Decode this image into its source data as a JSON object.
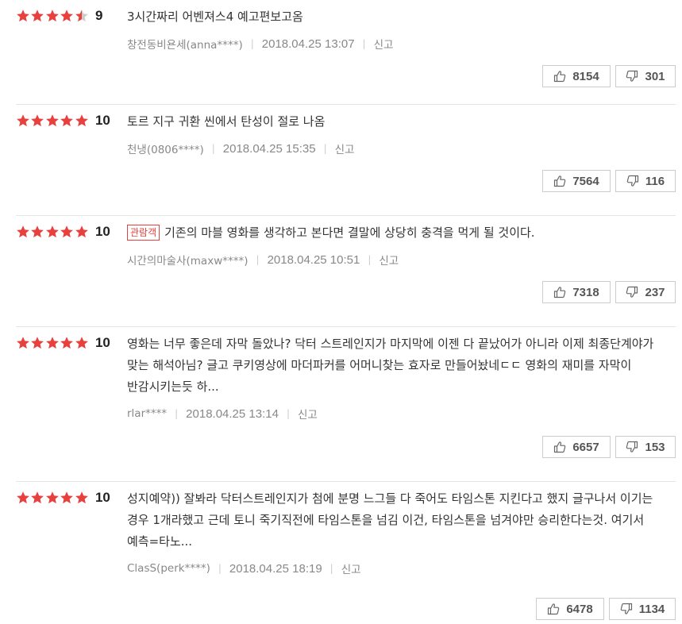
{
  "colors": {
    "star_full": "#e8403d",
    "star_empty": "#cccccc",
    "badge": "#e8403d"
  },
  "icons": {
    "like": "thumbs-up-icon",
    "dislike": "thumbs-down-icon",
    "star": "star-icon"
  },
  "report_label": "신고",
  "reviews": [
    {
      "rating_stars": 4.5,
      "score": "9",
      "badge": "",
      "text": "3시간짜리 어벤져스4 예고편보고옴",
      "author": "창전동비욘세(anna****)",
      "date": "2018.04.25 13:07",
      "likes": "8154",
      "dislikes": "301"
    },
    {
      "rating_stars": 5,
      "score": "10",
      "badge": "",
      "text": "토르 지구 귀환 씬에서 탄성이 절로 나옴",
      "author": "천냉(0806****)",
      "date": "2018.04.25 15:35",
      "likes": "7564",
      "dislikes": "116"
    },
    {
      "rating_stars": 5,
      "score": "10",
      "badge": "관람객",
      "text": "기존의 마블 영화를 생각하고 본다면 결말에 상당히 충격을 먹게 될 것이다.",
      "author": "시간의마술사(maxw****)",
      "date": "2018.04.25 10:51",
      "likes": "7318",
      "dislikes": "237"
    },
    {
      "rating_stars": 5,
      "score": "10",
      "badge": "",
      "text": "영화는 너무 좋은데 자막 돌았나? 닥터 스트레인지가 마지막에 이젠 다 끝났어가 아니라 이제 최종단계야가 맞는 해석아님? 글고 쿠키영상에 마더파커를 어머니찾는 효자로 만들어놨네ㄷㄷ 영화의 재미를 자막이 반감시키는듯 하...",
      "author": "rlar****",
      "date": "2018.04.25 13:14",
      "likes": "6657",
      "dislikes": "153"
    },
    {
      "rating_stars": 5,
      "score": "10",
      "badge": "",
      "text": "성지예약)) 잘봐라 닥터스트레인지가 첨에 분명 느그들 다 죽어도 타임스톤 지킨다고 했지 글구나서 이기는 경우 1개라했고 근데 토니 죽기직전에 타임스톤을 넘김 이건, 타임스톤을 넘겨야만 승리한다는것. 여기서 예측=타노...",
      "author": "ClasS(perk****)",
      "date": "2018.04.25 18:19",
      "likes": "6478",
      "dislikes": "1134"
    }
  ]
}
